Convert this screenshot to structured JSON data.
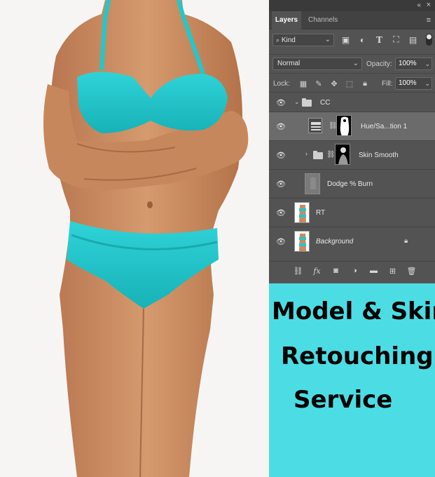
{
  "panel": {
    "tabs": [
      {
        "label": "Layers",
        "active": true
      },
      {
        "label": "Channels",
        "active": false
      }
    ],
    "filter": {
      "kind_label": "Kind",
      "icons": [
        "image-filter-icon",
        "adjustment-filter-icon",
        "type-filter-icon",
        "shape-filter-icon",
        "smart-object-filter-icon"
      ]
    },
    "blend_mode": "Normal",
    "opacity_label": "Opacity:",
    "opacity_value": "100%",
    "lock_label": "Lock:",
    "fill_label": "Fill:",
    "fill_value": "100%",
    "layers": [
      {
        "name": "CC",
        "type": "group",
        "expanded": true
      },
      {
        "name": "Hue/Sa...tion 1",
        "type": "adjustment",
        "selected": true
      },
      {
        "name": "Skin Smooth",
        "type": "group",
        "expanded": false
      },
      {
        "name": "Dodge % Burn",
        "type": "layer"
      },
      {
        "name": "RT",
        "type": "image"
      },
      {
        "name": "Background",
        "type": "image",
        "locked": true
      }
    ],
    "bottom_icons": [
      "link-layers-icon",
      "fx-icon",
      "mask-icon",
      "adjustment-layer-icon",
      "new-group-icon",
      "new-layer-icon",
      "trash-icon"
    ]
  },
  "promo": {
    "line1": "Model & Skin",
    "line2": "Retouching",
    "line3": "Service",
    "background": "#4bdde3"
  },
  "colors": {
    "panel_bg": "#535353",
    "selected_row": "#6b6b6b",
    "swimsuit": "#23c7cc",
    "skin": "#c98a5f"
  }
}
